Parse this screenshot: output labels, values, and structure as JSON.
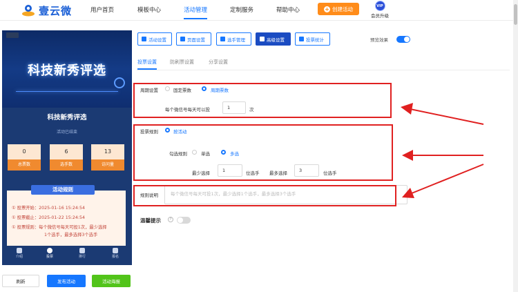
{
  "brand": {
    "name": "壹云微"
  },
  "nav": {
    "items": [
      "用户首页",
      "模板中心",
      "活动管理",
      "定制服务",
      "帮助中心"
    ],
    "active_index": 2,
    "create_label": "创建活动",
    "vip_badge": "VIP",
    "vip_label": "会员升级"
  },
  "preview": {
    "banner_title": "科技新秀评选",
    "title": "科技新秀评选",
    "status": "活动已结束",
    "stats": [
      {
        "value": "0",
        "label": "总票数"
      },
      {
        "value": "6",
        "label": "选手数"
      },
      {
        "value": "13",
        "label": "访问量"
      }
    ],
    "rules_title": "活动规则",
    "rules": [
      "① 投票开始：2025-01-16 15:24:54",
      "① 投票截止：2025-01-22 15:24:54",
      "① 投票规则：每个微信号每天可投1次，最少选择",
      "1个选手，最多选择3个选手"
    ],
    "tabbar": [
      "介绍",
      "投票",
      "排行",
      "报名"
    ],
    "tabbar_active": 1
  },
  "bottom_buttons": {
    "refresh": "刷新",
    "publish": "发布活动",
    "poster": "活动海报"
  },
  "toolbar": {
    "buttons": [
      "活动设置",
      "页面设置",
      "选手管理",
      "高级设置",
      "投票统计"
    ],
    "active_index": 3,
    "preview_label": "预览效果",
    "preview_on": true
  },
  "subtabs": {
    "items": [
      "投票设置",
      "防刷票设置",
      "分享设置"
    ],
    "active_index": 0
  },
  "form": {
    "cycle": {
      "label": "周期设置",
      "options": [
        "固定票数",
        "周期票数"
      ],
      "selected": 1,
      "per_day_label": "每个微信号每天可以投",
      "per_day_value": "1",
      "per_day_unit": "次"
    },
    "rule": {
      "label": "投票规则",
      "option": "按活动",
      "select_label": "勾选规则",
      "select_options": [
        "单选",
        "多选"
      ],
      "select_selected": 1,
      "min_label": "最少选择",
      "min_value": "1",
      "min_unit": "位选手",
      "max_label": "最多选择",
      "max_value": "3",
      "max_unit": "位选手"
    },
    "desc": {
      "label": "规则说明",
      "placeholder": "每个微信号每天可投1次，最少选择1个选手，最多选择3个选手"
    },
    "tip": {
      "label": "温馨提示",
      "on": false
    }
  },
  "colors": {
    "accent": "#1677ff",
    "annotation_red": "#e02020",
    "orange": "#ff8c1a",
    "green": "#52c41a"
  }
}
